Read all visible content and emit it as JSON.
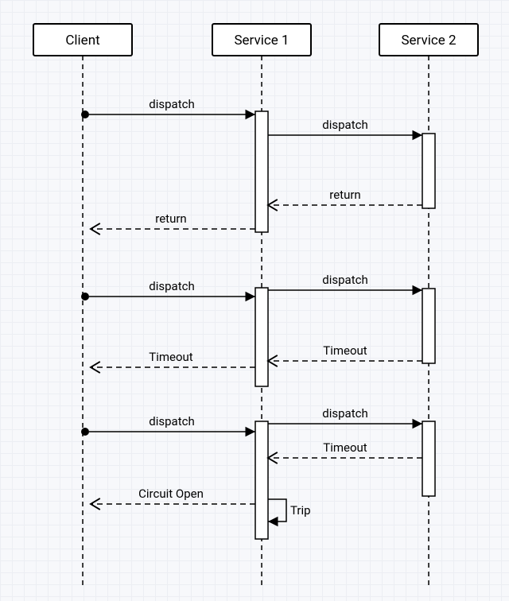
{
  "actors": {
    "client": "Client",
    "service1": "Service 1",
    "service2": "Service 2"
  },
  "labels": {
    "dispatch": "dispatch",
    "return": "return",
    "timeout": "Timeout",
    "circuit_open": "Circuit Open",
    "trip": "Trip"
  }
}
